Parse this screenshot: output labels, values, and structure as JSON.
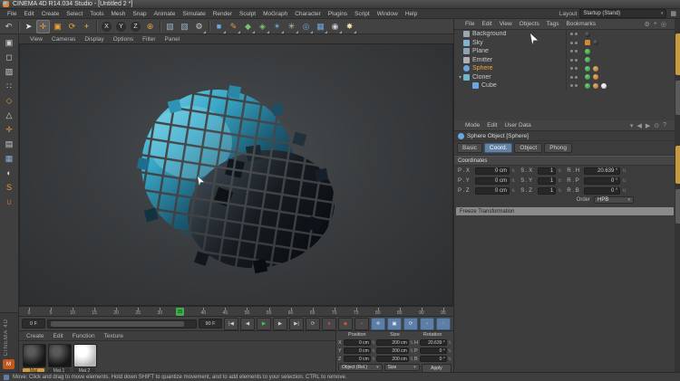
{
  "window": {
    "title": "CINEMA 4D R14.034 Studio - [Untitled 2 *]"
  },
  "menus": [
    "File",
    "Edit",
    "Create",
    "Select",
    "Tools",
    "Mesh",
    "Snap",
    "Animate",
    "Simulate",
    "Render",
    "Sculpt",
    "MoGraph",
    "Character",
    "Plugins",
    "Script",
    "Window",
    "Help"
  ],
  "layout_selector": {
    "label": "Layout",
    "value": "Startup (Stand)"
  },
  "toolbar": {
    "items": [
      {
        "name": "undo-icon",
        "glyph": "↶",
        "color": "#d0d0d0"
      },
      {
        "name": "toolbar-separator",
        "sep": true
      },
      {
        "name": "live-selection-icon",
        "glyph": "➤",
        "color": "#e8e8e8"
      },
      {
        "name": "move-tool-icon",
        "glyph": "✛",
        "color": "#f0a030",
        "active": true
      },
      {
        "name": "scale-tool-icon",
        "glyph": "▣",
        "color": "#f0a030"
      },
      {
        "name": "rotate-tool-icon",
        "glyph": "⟳",
        "color": "#f0a030"
      },
      {
        "name": "last-tool-icon",
        "glyph": "+",
        "color": "#f0c040"
      },
      {
        "name": "toolbar-separator",
        "sep": true
      },
      {
        "name": "lock-x-axis-icon",
        "glyph": "X",
        "axis": true
      },
      {
        "name": "lock-y-axis-icon",
        "glyph": "Y",
        "axis": true
      },
      {
        "name": "lock-z-axis-icon",
        "glyph": "Z",
        "axis": true
      },
      {
        "name": "coordinate-system-icon",
        "glyph": "⊕",
        "color": "#e0a040"
      },
      {
        "name": "toolbar-separator",
        "sep": true
      },
      {
        "name": "render-view-icon",
        "glyph": "▧",
        "color": "#9ab0c4"
      },
      {
        "name": "render-region-icon",
        "glyph": "▨",
        "color": "#9ab0c4"
      },
      {
        "name": "render-settings-icon",
        "glyph": "⚙",
        "color": "#c8c8c8",
        "dd": true
      },
      {
        "name": "toolbar-separator",
        "sep": true
      },
      {
        "name": "cube-primitive-icon",
        "glyph": "■",
        "color": "#6aa7e0",
        "dd": true
      },
      {
        "name": "spline-pen-icon",
        "glyph": "✎",
        "color": "#e09a3c",
        "dd": true
      },
      {
        "name": "subdivision-surface-icon",
        "glyph": "◆",
        "color": "#79c274",
        "dd": true
      },
      {
        "name": "generator-icon",
        "glyph": "◈",
        "color": "#79c274",
        "dd": true
      },
      {
        "name": "mograph-cloner-icon",
        "glyph": "✶",
        "color": "#6aa7e0",
        "dd": true
      },
      {
        "name": "particles-icon",
        "glyph": "✳",
        "color": "#c0c0c0",
        "dd": true
      },
      {
        "name": "deformer-icon",
        "glyph": "◎",
        "color": "#6aa7e0",
        "dd": true
      },
      {
        "name": "floor-environment-icon",
        "glyph": "▦",
        "color": "#6aa7e0",
        "dd": true
      },
      {
        "name": "camera-icon",
        "glyph": "◉",
        "color": "#cfcfcf",
        "dd": true
      },
      {
        "name": "light-icon",
        "glyph": "✸",
        "color": "#f2e2a0",
        "dd": true
      }
    ]
  },
  "left_toolbar": {
    "items": [
      {
        "name": "make-editable-icon",
        "glyph": "▣",
        "color": "#cfcfcf"
      },
      {
        "name": "model-mode-icon",
        "glyph": "◻",
        "color": "#cfcfcf"
      },
      {
        "name": "texture-mode-icon",
        "glyph": "▨",
        "color": "#cfcfcf"
      },
      {
        "name": "points-mode-icon",
        "glyph": "∷",
        "color": "#cfcfcf"
      },
      {
        "name": "edges-mode-icon",
        "glyph": "◇",
        "color": "#e09a3c"
      },
      {
        "name": "polygons-mode-icon",
        "glyph": "△",
        "color": "#cfcfcf"
      },
      {
        "name": "axis-mode-icon",
        "glyph": "✛",
        "color": "#e09a3c"
      },
      {
        "name": "texture-axis-icon",
        "glyph": "▤",
        "color": "#cfcfcf"
      },
      {
        "name": "workplane-icon",
        "glyph": "▦",
        "color": "#8fb0d0"
      },
      {
        "name": "solo-mode-icon",
        "glyph": "◐",
        "color": "#cfcfcf"
      },
      {
        "name": "snap-icon",
        "glyph": "S",
        "color": "#e09a3c"
      },
      {
        "name": "magnet-icon",
        "glyph": "∪",
        "color": "#c06a40"
      }
    ]
  },
  "viewport_menu": [
    "View",
    "Cameras",
    "Display",
    "Options",
    "Filter",
    "Panel"
  ],
  "object_manager": {
    "menu": [
      "File",
      "Edit",
      "View",
      "Objects",
      "Tags",
      "Bookmarks"
    ],
    "menu_icons": [
      {
        "name": "filter-icon",
        "glyph": "⚙"
      },
      {
        "name": "add-layer-icon",
        "glyph": "+"
      },
      {
        "name": "search-icon",
        "glyph": "◎"
      }
    ],
    "objects": [
      {
        "name": "Background",
        "icon": "ic-background",
        "tex": "tex-dark"
      },
      {
        "name": "Sky",
        "icon": "ic-sky",
        "comp": true,
        "tex": "tex-dark"
      },
      {
        "name": "Plane",
        "icon": "ic-plane",
        "check": true
      },
      {
        "name": "Emitter",
        "icon": "ic-emitter",
        "check": true
      },
      {
        "name": "Sphere",
        "icon": "ic-sphere",
        "selected": true,
        "check": true,
        "phong": true
      },
      {
        "name": "Cloner",
        "icon": "ic-cloner",
        "expander": "▾",
        "check": true,
        "phong": true
      },
      {
        "name": "Cube",
        "icon": "ic-cube",
        "child": true,
        "check": true,
        "phong": true,
        "tex": "tex-white"
      }
    ]
  },
  "attribute_manager": {
    "menu": [
      "Mode",
      "Edit",
      "User Data"
    ],
    "menu_icons": [
      {
        "name": "dropdown-arrow-icon",
        "glyph": "▾"
      },
      {
        "name": "history-back-icon",
        "glyph": "◀"
      },
      {
        "name": "history-forward-icon",
        "glyph": "▶"
      },
      {
        "name": "lock-icon",
        "glyph": "⊙"
      },
      {
        "name": "help-icon",
        "glyph": "?"
      }
    ],
    "title": "Sphere Object [Sphere]",
    "tabs": [
      {
        "label": "Basic"
      },
      {
        "label": "Coord.",
        "active": true
      },
      {
        "label": "Object"
      },
      {
        "label": "Phong"
      }
    ],
    "section": "Coordinates",
    "rows": [
      {
        "p_label": "P . X",
        "p": "0 cm",
        "s_label": "S . X",
        "s": "1",
        "r_label": "R . H",
        "r": "20.639 °"
      },
      {
        "p_label": "P . Y",
        "p": "0 cm",
        "s_label": "S . Y",
        "s": "1",
        "r_label": "R . P",
        "r": "0 °"
      },
      {
        "p_label": "P . Z",
        "p": "0 cm",
        "s_label": "S . Z",
        "s": "1",
        "r_label": "R . B",
        "r": "0 °"
      }
    ],
    "order_label": "Order",
    "order_value": "HPB",
    "freeze_section": "Freeze Transformation"
  },
  "timeline": {
    "frames": [
      "0",
      "5",
      "10",
      "15",
      "20",
      "25",
      "30",
      "35",
      "40",
      "45",
      "50",
      "55",
      "60",
      "65",
      "70",
      "75",
      "80",
      "85",
      "90",
      "95"
    ],
    "playhead_frame": 35,
    "max_frame": 95,
    "range_start": "0 F",
    "range_end": "90 F"
  },
  "transport": {
    "buttons": [
      {
        "name": "goto-start-button",
        "glyph": "|◀",
        "cls": ""
      },
      {
        "name": "prev-frame-button",
        "glyph": "◀",
        "cls": ""
      },
      {
        "name": "play-button",
        "glyph": "▶",
        "cls": "green"
      },
      {
        "name": "next-frame-button",
        "glyph": "▶",
        "cls": ""
      },
      {
        "name": "goto-end-button",
        "glyph": "▶|",
        "cls": ""
      },
      {
        "name": "loop-button",
        "glyph": "⟳",
        "cls": ""
      },
      {
        "name": "record-keyframe-button",
        "glyph": "●",
        "cls": "red"
      },
      {
        "name": "autokey-button",
        "glyph": "◆",
        "cls": "red"
      },
      {
        "name": "keyframe-selection-button",
        "glyph": "▪",
        "cls": "red"
      },
      {
        "name": "record-position-button",
        "glyph": "✛",
        "cls": "blue"
      },
      {
        "name": "record-scale-button",
        "glyph": "▣",
        "cls": "blue"
      },
      {
        "name": "record-rotation-button",
        "glyph": "⟳",
        "cls": "blue"
      },
      {
        "name": "record-parameter-button",
        "glyph": "◦",
        "cls": "blue"
      },
      {
        "name": "record-point-level-button",
        "glyph": "∴",
        "cls": "blue"
      }
    ]
  },
  "materials": {
    "menu": [
      "Create",
      "Edit",
      "Function",
      "Texture"
    ],
    "items": [
      {
        "name": "Mat",
        "kind": "sphere-dark",
        "selected": true
      },
      {
        "name": "Mat.1",
        "kind": "sphere-dark"
      },
      {
        "name": "Mat.2",
        "kind": "sphere-white"
      }
    ]
  },
  "coordinates_panel": {
    "headers": [
      "Position",
      "Size",
      "Rotation"
    ],
    "rows": [
      {
        "axis": "X",
        "pos": "0 cm",
        "size": "200 cm",
        "rot_axis": "H",
        "rot": "20.639 °"
      },
      {
        "axis": "Y",
        "pos": "0 cm",
        "size": "200 cm",
        "rot_axis": "P",
        "rot": "0 °"
      },
      {
        "axis": "Z",
        "pos": "0 cm",
        "size": "200 cm",
        "rot_axis": "B",
        "rot": "0 °"
      }
    ],
    "mode_value": "Object (Rel.)",
    "size_value": "Size",
    "apply_label": "Apply"
  },
  "status_bar": {
    "text": "Move: Click and drag to move elements. Hold down SHIFT to quantize movement, and to add elements to your selection. CTRL to remove."
  },
  "branding": {
    "vertical_text": "CINEMA 4D",
    "badge": "M"
  },
  "colors": {
    "accent_orange": "#f0a030",
    "selection_orange": "#e8a33d",
    "tab_blue": "#6281a3",
    "playhead_green": "#3fae49",
    "cube_teal": "#3aa8c8"
  }
}
